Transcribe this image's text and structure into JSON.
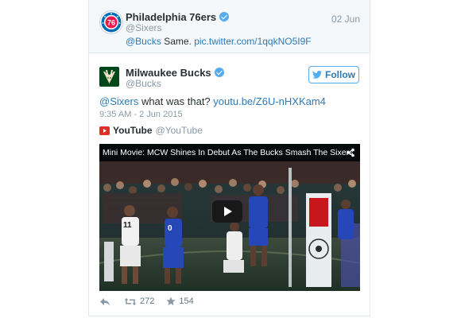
{
  "parent_tweet": {
    "name": "Philadelphia 76ers",
    "handle": "@Sixers",
    "date": "02 Jun",
    "text_mention": "@Bucks",
    "text_body": " Same. ",
    "text_link": "pic.twitter.com/1qqkNO5I9F"
  },
  "tweet": {
    "name": "Milwaukee Bucks",
    "handle": "@Bucks",
    "follow_label": "Follow",
    "text_mention": "@Sixers",
    "text_body": " what was that? ",
    "text_link": "youtu.be/Z6U-nHXKam4",
    "timestamp": "9:35 AM - 2 Jun 2015"
  },
  "card": {
    "source_name": "YouTube",
    "source_handle": "@YouTube",
    "video_title": "Mini Movie: MCW Shines In Debut As The Bucks Smash The Sixers",
    "jersey_left": "11",
    "jersey_right": "0"
  },
  "actions": {
    "retweets": "272",
    "favorites": "154"
  },
  "colors": {
    "link": "#2b7bb9",
    "verified": "#55acee",
    "bucks_green": "#00471b",
    "sixers_blue": "#006bb6",
    "youtube_red": "#e52d27"
  }
}
